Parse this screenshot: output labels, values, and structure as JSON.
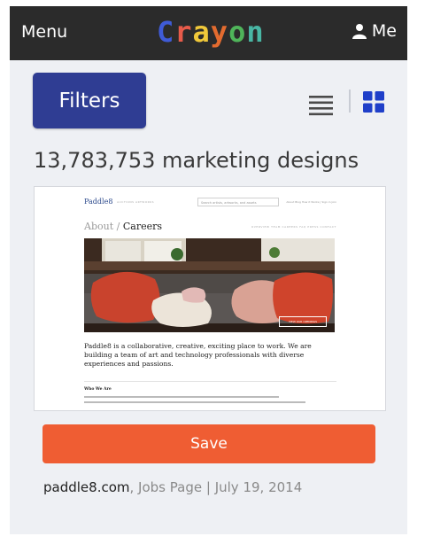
{
  "header": {
    "menu_label": "Menu",
    "logo_letters": [
      {
        "char": "C",
        "color": "#3f5bd6"
      },
      {
        "char": "r",
        "color": "#e85b4a"
      },
      {
        "char": "a",
        "color": "#f0c83a"
      },
      {
        "char": "y",
        "color": "#e36b2f"
      },
      {
        "char": "o",
        "color": "#4fb45a"
      },
      {
        "char": "n",
        "color": "#49b6a4"
      }
    ],
    "me_label": "Me",
    "me_icon": "person-icon"
  },
  "toolbar": {
    "filters_label": "Filters",
    "filters_color": "#2f3d93",
    "list_view_icon": "list-view-icon",
    "grid_view_icon": "grid-view-icon",
    "grid_view_color": "#1f3fc9"
  },
  "results": {
    "count_text": "13,783,753 marketing designs"
  },
  "design": {
    "preview": {
      "logo": "Paddle8",
      "nav": "AUCTIONS   ARTWORKS",
      "search_placeholder": "Search artists, artworks, and assets",
      "top_links": "About   Blog   How it Works   |   Sign in   Join",
      "title_muted": "About",
      "title_separator": "/",
      "title": "Careers",
      "subnav": "OVERVIEW   TEAM   CAREERS   FAQ   PRESS   CONTACT",
      "photo_button": "VIEW OUR OPENINGS",
      "body_text": "Paddle8 is a collaborative, creative, exciting place to work. We are building a team of art and technology professionals with diverse experiences and passions.",
      "section_heading": "Who We Are"
    },
    "save_label": "Save",
    "save_color": "#ef5d33",
    "site": "paddle8.com",
    "page_type": "Jobs Page",
    "separator": "|",
    "date": "July 19, 2014"
  }
}
